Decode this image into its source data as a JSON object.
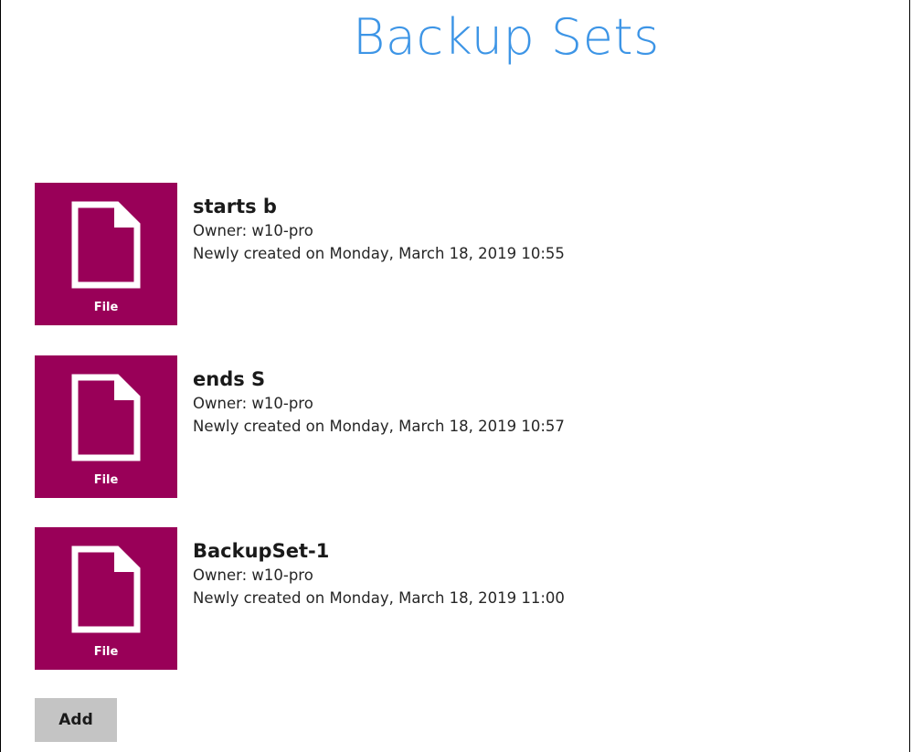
{
  "header": {
    "title": "Backup Sets"
  },
  "backup_sets": [
    {
      "name": "starts b",
      "owner": "Owner: w10-pro",
      "created": "Newly created on Monday, March 18, 2019 10:55",
      "type_label": "File",
      "icon": "file-icon"
    },
    {
      "name": "ends S",
      "owner": "Owner: w10-pro",
      "created": "Newly created on Monday, March 18, 2019 10:57",
      "type_label": "File",
      "icon": "file-icon"
    },
    {
      "name": "BackupSet-1",
      "owner": "Owner: w10-pro",
      "created": "Newly created on Monday, March 18, 2019 11:00",
      "type_label": "File",
      "icon": "file-icon"
    }
  ],
  "actions": {
    "add_label": "Add"
  },
  "colors": {
    "title": "#3d95e6",
    "tile": "#990058",
    "button": "#c4c4c4"
  }
}
